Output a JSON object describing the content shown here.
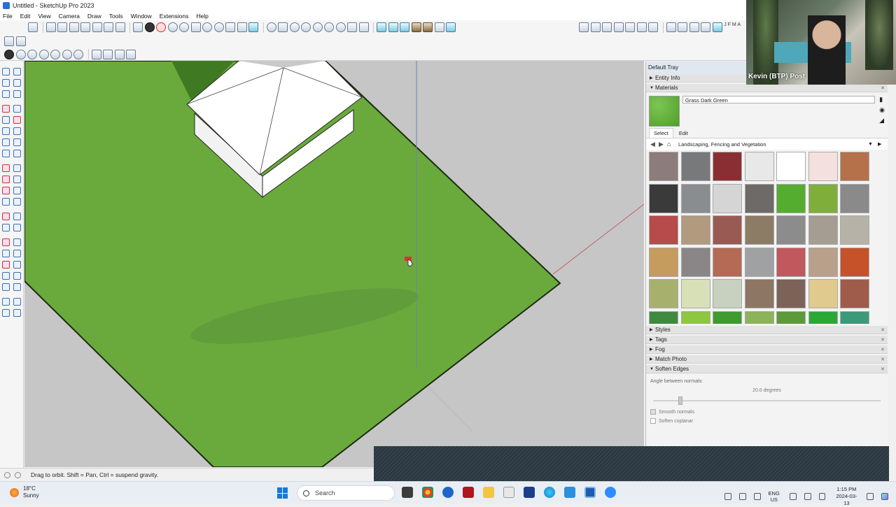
{
  "window": {
    "title": "Untitled - SketchUp Pro 2023"
  },
  "menu": [
    "File",
    "Edit",
    "View",
    "Camera",
    "Draw",
    "Tools",
    "Window",
    "Extensions",
    "Help"
  ],
  "toolbar_months": "J F M A",
  "tray": {
    "title": "Default Tray",
    "entity_info": "Entity Info",
    "materials": "Materials",
    "material_name": "Grass Dark Green",
    "tab_select": "Select",
    "tab_edit": "Edit",
    "library": "Landscaping, Fencing and Vegetation",
    "styles": "Styles",
    "tags": "Tags",
    "fog": "Fog",
    "match_photo": "Match Photo",
    "soften_edges": "Soften Edges",
    "angle_label": "Angle between normals:",
    "angle_value": "20.0  degrees",
    "smooth_normals": "Smooth normals",
    "soften_coplanar": "Soften coplanar"
  },
  "webcam": {
    "name": "Kevin (BTP) Post"
  },
  "status": {
    "text": "Drag to orbit. Shift = Pan, Ctrl = suspend gravity."
  },
  "taskbar": {
    "temperature": "18°C",
    "condition": "Sunny",
    "search_placeholder": "Search",
    "lang_1": "ENG",
    "lang_2": "US",
    "time": "1:15 PM",
    "date": "2024-03-13"
  },
  "colors": {
    "grass": "#6aaa3c",
    "viewport_bg": "#c6c6c6",
    "accent_blue": "#2a6fd6"
  },
  "material_swatches": [
    "#8d7c7c",
    "#77797b",
    "#8b2e33",
    "#e8e8e8",
    "#ffffff",
    "#f5e0e0",
    "#b4714a",
    "#3a3a3a",
    "#8a8d90",
    "#d5d5d5",
    "#6d6a68",
    "#55ad30",
    "#7fae3a",
    "#8a8a8a",
    "#b74a4a",
    "#b19a7e",
    "#9a5a54",
    "#8c7b65",
    "#8c8c8c",
    "#a59d91",
    "#b7b2a8",
    "#c59b5e",
    "#8a8586",
    "#b46a54",
    "#9fa1a3",
    "#c0585e",
    "#b8a08a",
    "#c6522a",
    "#a8b06e",
    "#d8e0b8",
    "#c8d0c0",
    "#8d7664",
    "#7d6258",
    "#e0ca8e",
    "#a05c4a",
    "#3f8a3f",
    "#8dc63f",
    "#3f9a2f",
    "#8ab35a",
    "#5c9a3a",
    "#2aa836",
    "#3a9a7a"
  ]
}
